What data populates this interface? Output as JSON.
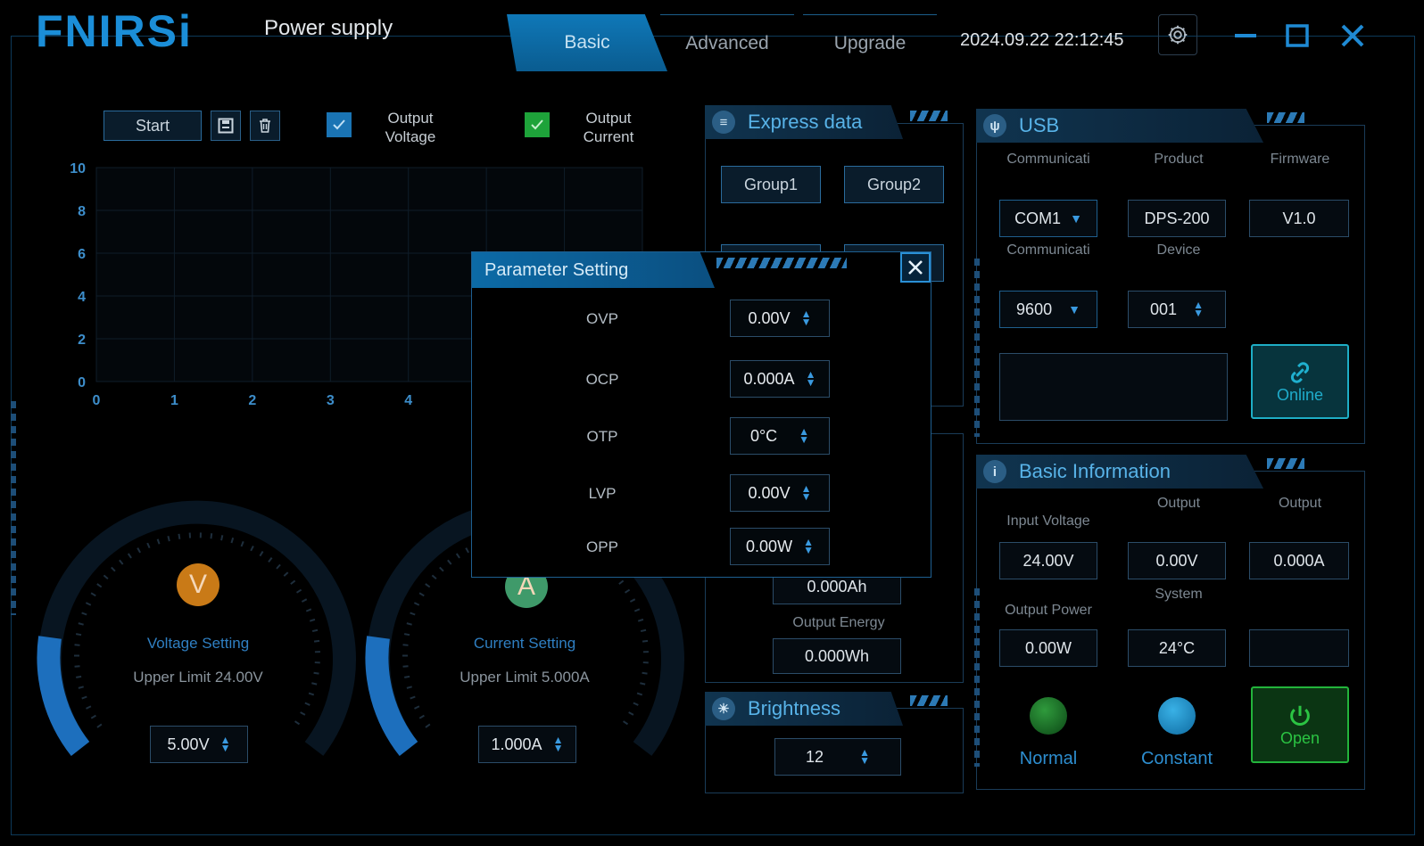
{
  "header": {
    "logo_text": "FNIRSi",
    "app_title": "Power supply",
    "tabs": [
      {
        "label": "Basic",
        "active": true
      },
      {
        "label": "Advanced",
        "active": false
      },
      {
        "label": "Upgrade",
        "active": false
      }
    ],
    "datetime": "2024.09.22 22:12:45"
  },
  "toolbar": {
    "start_label": "Start",
    "save_icon": "save-icon",
    "delete_icon": "trash-icon",
    "output_voltage_label_1": "Output",
    "output_voltage_label_2": "Voltage",
    "output_current_label_1": "Output",
    "output_current_label_2": "Current",
    "voltage_check_color": "#1a74b4",
    "current_check_color": "#1ea33a"
  },
  "chart_data": {
    "type": "line",
    "series": [],
    "xlim": [
      0,
      4
    ],
    "ylim": [
      0,
      10
    ],
    "x_ticks": [
      "0",
      "1",
      "2",
      "3",
      "4"
    ],
    "y_ticks": [
      "10",
      "8",
      "6",
      "4",
      "2",
      "0"
    ],
    "grid": true
  },
  "voltage_gauge": {
    "knob_letter": "V",
    "knob_color": "#c97a17",
    "title": "Voltage Setting",
    "limit": "Upper Limit 24.00V",
    "value": "5.00V"
  },
  "current_gauge": {
    "knob_letter": "A",
    "knob_color": "#3f9a6a",
    "title": "Current Setting",
    "limit": "Upper Limit 5.000A",
    "value": "1.000A"
  },
  "express": {
    "title": "Express data",
    "group1": "Group1",
    "group2": "Group2",
    "capacity_value": "0.000Ah",
    "energy_label": "Output Energy",
    "energy_value": "0.000Wh"
  },
  "brightness": {
    "title": "Brightness",
    "value": "12"
  },
  "usb": {
    "title": "USB",
    "col1_label": "Communicati",
    "col2_label": "Product",
    "col3_label": "Firmware",
    "port": "COM1",
    "product": "DPS-200",
    "firmware": "V1.0",
    "row2_label1": "Communicati",
    "row2_label2": "Device",
    "baud": "9600",
    "device": "001",
    "online_label": "Online"
  },
  "basic_info": {
    "title": "Basic Information",
    "input_voltage_label": "Input Voltage",
    "output_label_a": "Output",
    "output_label_b": "Output",
    "input_voltage": "24.00V",
    "output_voltage": "0.00V",
    "output_current": "0.000A",
    "output_power_label": "Output Power",
    "system_label": "System",
    "output_power": "0.00W",
    "system_temp": "24°C",
    "normal_label": "Normal",
    "constant_label": "Constant",
    "open_label": "Open"
  },
  "parameter_dialog": {
    "title": "Parameter Setting",
    "rows": [
      {
        "label": "OVP",
        "value": "0.00V"
      },
      {
        "label": "OCP",
        "value": "0.000A"
      },
      {
        "label": "OTP",
        "value": "0°C"
      },
      {
        "label": "LVP",
        "value": "0.00V"
      },
      {
        "label": "OPP",
        "value": "0.00W"
      }
    ]
  }
}
